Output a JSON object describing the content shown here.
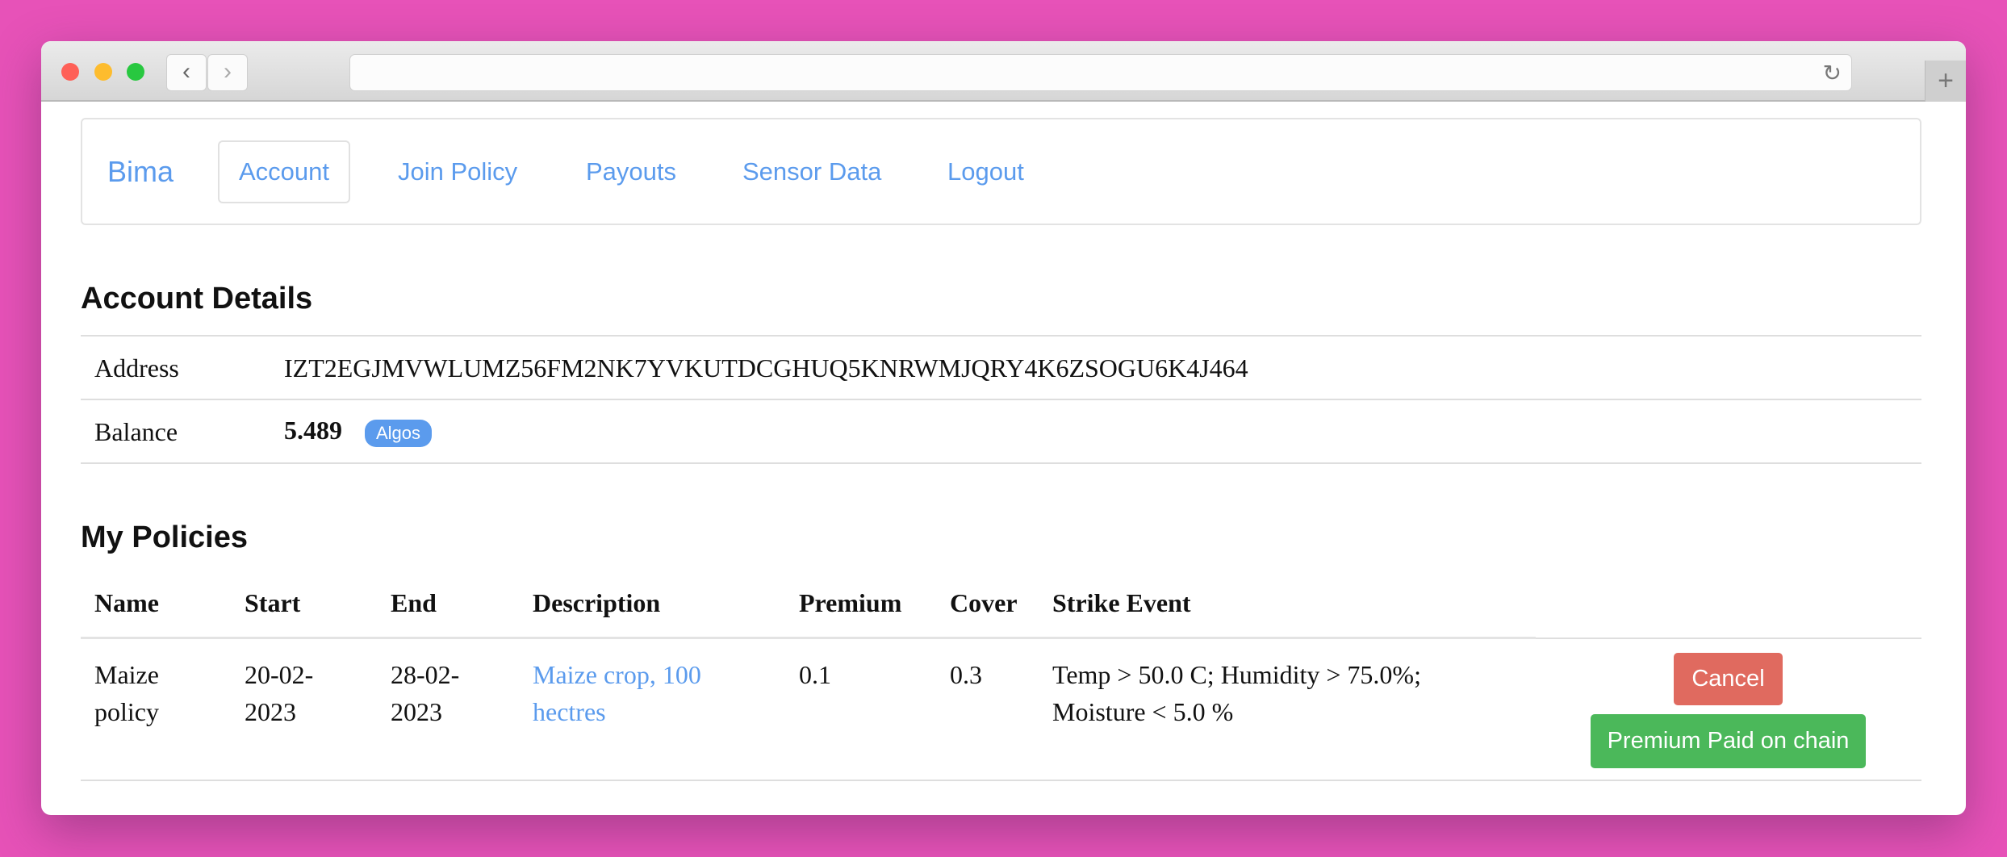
{
  "browser": {
    "back": "‹",
    "forward": "›",
    "reload": "↻",
    "new_tab": "+",
    "colors": {
      "close": "#fe6057",
      "minimize": "#fdbc2e",
      "maximize": "#28c840"
    }
  },
  "navbar": {
    "brand": "Bima",
    "links": [
      "Account",
      "Join Policy",
      "Payouts",
      "Sensor Data",
      "Logout"
    ],
    "active": "Account"
  },
  "account": {
    "title": "Account Details",
    "address_label": "Address",
    "address": "IZT2EGJMVWLUMZ56FM2NK7YVKUTDCGHUQ5KNRWMJQRY4K6ZSOGU6K4J464",
    "balance_label": "Balance",
    "balance": "5.489",
    "unit": "Algos"
  },
  "policies": {
    "title": "My Policies",
    "headers": [
      "Name",
      "Start",
      "End",
      "Description",
      "Premium",
      "Cover",
      "Strike Event"
    ],
    "rows": [
      {
        "name": "Maize policy",
        "start": "20-02-2023",
        "end": "28-02-2023",
        "description": "Maize crop, 100 hectres",
        "premium": "0.1",
        "cover": "0.3",
        "strike": "Temp > 50.0 C; Humidity > 75.0%; Moisture < 5.0 %",
        "cancel": "Cancel",
        "status": "Premium Paid on chain"
      }
    ]
  }
}
